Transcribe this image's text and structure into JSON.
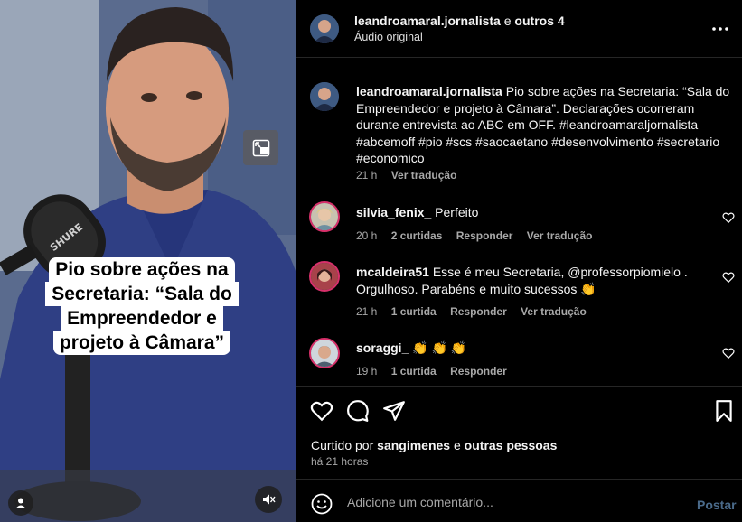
{
  "video": {
    "caption_lines": [
      "Pio sobre ações na",
      "Secretaria: “Sala do",
      "Empreendedor e",
      "projeto à Câmara”"
    ],
    "mic_brand": "SHURE"
  },
  "header": {
    "username": "leandroamaral.jornalista",
    "joiner": " e ",
    "others": "outros 4",
    "audio": "Áudio original"
  },
  "caption": {
    "username": "leandroamaral.jornalista",
    "text": " Pio sobre ações na Secretaria: “Sala do Empreendedor e projeto à Câmara”. Declarações ocorreram durante entrevista ao ABC em OFF. #leandroamaraljornalista #abcemoff #pio #scs #saocaetano #desenvolvimento #secretario #economico",
    "time": "21 h",
    "translate": "Ver tradução"
  },
  "comments": [
    {
      "username": "silvia_fenix_",
      "text": " Perfeito",
      "time": "20 h",
      "likes": "2 curtidas",
      "reply": "Responder",
      "translate": "Ver tradução"
    },
    {
      "username": "mcaldeira51",
      "text": " Esse é meu Secretaria, @professorpiomielo . Orgulhoso. Parabéns e muito sucessos 👏",
      "time": "21 h",
      "likes": "1 curtida",
      "reply": "Responder",
      "translate": "Ver tradução"
    },
    {
      "username": "soraggi_",
      "text": " 👏 👏 👏",
      "time": "19 h",
      "likes": "1 curtida",
      "reply": "Responder"
    }
  ],
  "likes": {
    "prefix": "Curtido por ",
    "user": "sangimenes",
    "middle": " e ",
    "others": "outras pessoas",
    "ago": "há 21 horas"
  },
  "composer": {
    "placeholder": "Adicione um comentário...",
    "post_label": "Postar"
  },
  "colors": {
    "accent_link": "#4a6a8a",
    "story_ring": "#d8306a",
    "panel_bg": "#000000"
  }
}
